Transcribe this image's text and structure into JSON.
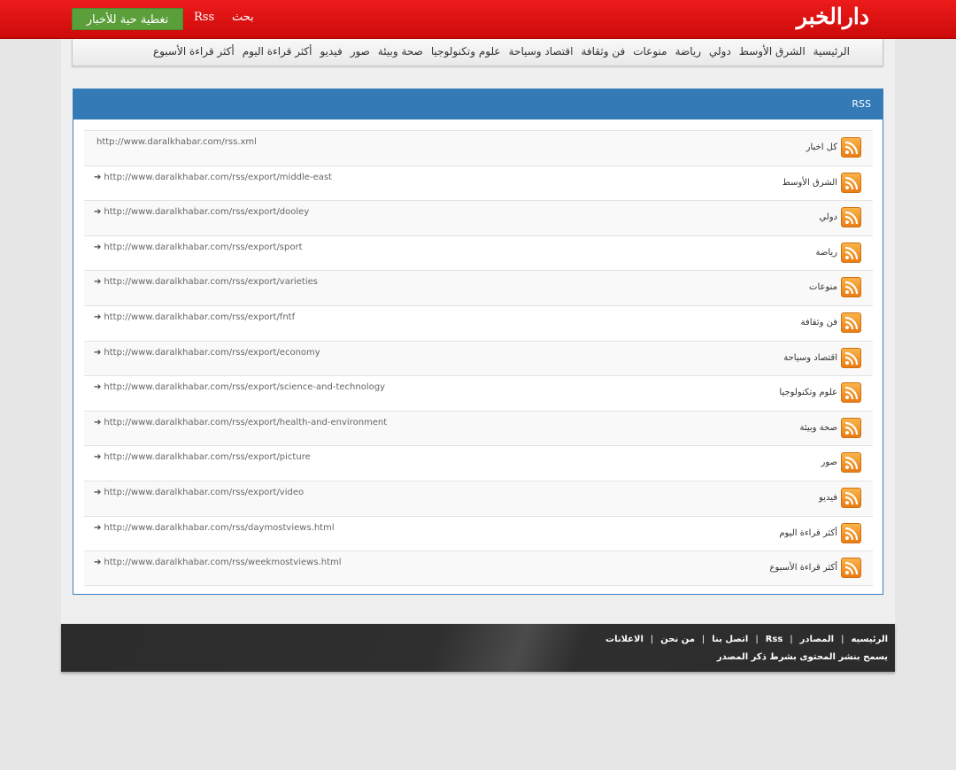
{
  "header": {
    "logo": "دارالخبر",
    "live_button": "تغطية حية للأخبار",
    "rss_link": "Rss",
    "search_link": "بحث"
  },
  "nav": {
    "items": [
      "الرئيسية",
      "الشرق الأوسط",
      "دولي",
      "رياضة",
      "منوعات",
      "فن وثقافة",
      "اقتصاد وسياحة",
      "علوم وتكنولوجيا",
      "صحة وبيئة",
      "صور",
      "فيديو",
      "أكثر قراءة اليوم",
      "أكثر قراءة الأسبوع"
    ]
  },
  "panel": {
    "title": "RSS",
    "feeds": [
      {
        "name": "كل اخبار",
        "url": "http://www.daralkhabar.com/rss.xml",
        "arrow": ""
      },
      {
        "name": "الشرق الأوسط",
        "url": "http://www.daralkhabar.com/rss/export/middle-east",
        "arrow": "➔"
      },
      {
        "name": "دولي",
        "url": "http://www.daralkhabar.com/rss/export/dooley",
        "arrow": "➔"
      },
      {
        "name": "رياضة",
        "url": "http://www.daralkhabar.com/rss/export/sport",
        "arrow": "➔"
      },
      {
        "name": "منوعات",
        "url": "http://www.daralkhabar.com/rss/export/varieties",
        "arrow": "➔"
      },
      {
        "name": "فن وثقافة",
        "url": "http://www.daralkhabar.com/rss/export/fntf",
        "arrow": "➔"
      },
      {
        "name": "اقتصاد وسياحة",
        "url": "http://www.daralkhabar.com/rss/export/economy",
        "arrow": "➔"
      },
      {
        "name": "علوم وتكنولوجيا",
        "url": "http://www.daralkhabar.com/rss/export/science-and-technology",
        "arrow": "➔"
      },
      {
        "name": "صحة وبيئة",
        "url": "http://www.daralkhabar.com/rss/export/health-and-environment",
        "arrow": "➔"
      },
      {
        "name": "صور",
        "url": "http://www.daralkhabar.com/rss/export/picture",
        "arrow": "➔"
      },
      {
        "name": "فيديو",
        "url": "http://www.daralkhabar.com/rss/export/video",
        "arrow": "➔"
      },
      {
        "name": "أكثر قراءة اليوم",
        "url": "http://www.daralkhabar.com/rss/daymostviews.html",
        "arrow": "➔"
      },
      {
        "name": "أكثر قراءة الأسبوع",
        "url": "http://www.daralkhabar.com/rss/weekmostviews.html",
        "arrow": "➔"
      }
    ]
  },
  "footer": {
    "links": [
      "الرئيسيه",
      "المصادر",
      "Rss",
      "اتصل بنا",
      "من نحن",
      "الاعلانات"
    ],
    "note": "يسمح بنشر المحتوى بشرط ذكر المصدر"
  },
  "colors": {
    "header_red": "#e01010",
    "live_green": "#5b9f3b",
    "panel_blue": "#337ab7",
    "feed_orange": "#f0901e",
    "footer_dark": "#2c2c2c"
  }
}
